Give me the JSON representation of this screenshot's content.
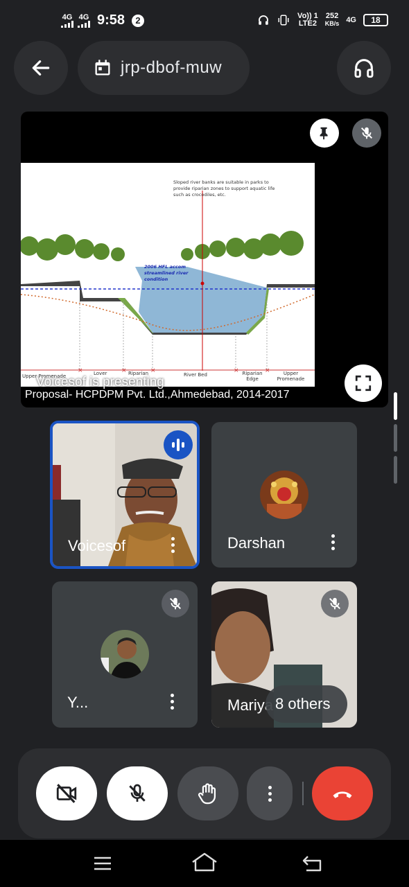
{
  "status_bar": {
    "sim1": "4G",
    "sim2": "4G",
    "time": "9:58",
    "notif_count": "2",
    "volte_line1": "Vo)) 1",
    "volte_line2": "LTE2",
    "speed_value": "252",
    "speed_unit": "KB/s",
    "net": "4G",
    "battery": "18"
  },
  "top_bar": {
    "meeting_code": "jrp-dbof-muw",
    "back_icon": "arrow-left-icon",
    "calendar_icon": "calendar-icon",
    "audio_icon": "headphones-icon"
  },
  "presentation": {
    "presenting_label": "Voicesof is presenting",
    "slide_footer": "Proposal- HCPDPM Pvt. Ltd.,Ahmedebad, 2014-2017",
    "slide": {
      "annotation": "Sloped river banks are suitable in parks to provide riparian zones to support aquatic life such as crocodiles, etc.",
      "hfl_label_1": "2006 HFL accom",
      "hfl_label_2": "streamlined river",
      "hfl_label_3": "condition",
      "zones": [
        "Upper Promenade",
        "Lover",
        "Riparian",
        "River Bed",
        "Riparian Edge",
        "Upper Promenade"
      ]
    }
  },
  "participants": [
    {
      "name": "Voicesof",
      "speaking": true,
      "muted": false
    },
    {
      "name": "Darshan",
      "speaking": false,
      "muted": false
    },
    {
      "name": "Y...",
      "speaking": false,
      "muted": true
    },
    {
      "name": "Mariya",
      "speaking": false,
      "muted": true
    }
  ],
  "others_label": "8 others",
  "colors": {
    "background": "#202124",
    "surface": "#2d2e31",
    "tile": "#3c4043",
    "active_border": "#1a54c4",
    "end_call": "#ea4335"
  }
}
